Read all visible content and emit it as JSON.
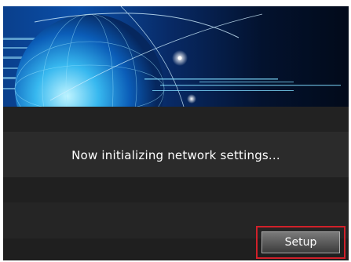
{
  "status_message": "Now initializing network settings...",
  "setup_button_label": "Setup",
  "colors": {
    "background": "#1b1b1b",
    "highlight_frame": "#d0202a",
    "banner_accent": "#6fd3ff"
  }
}
